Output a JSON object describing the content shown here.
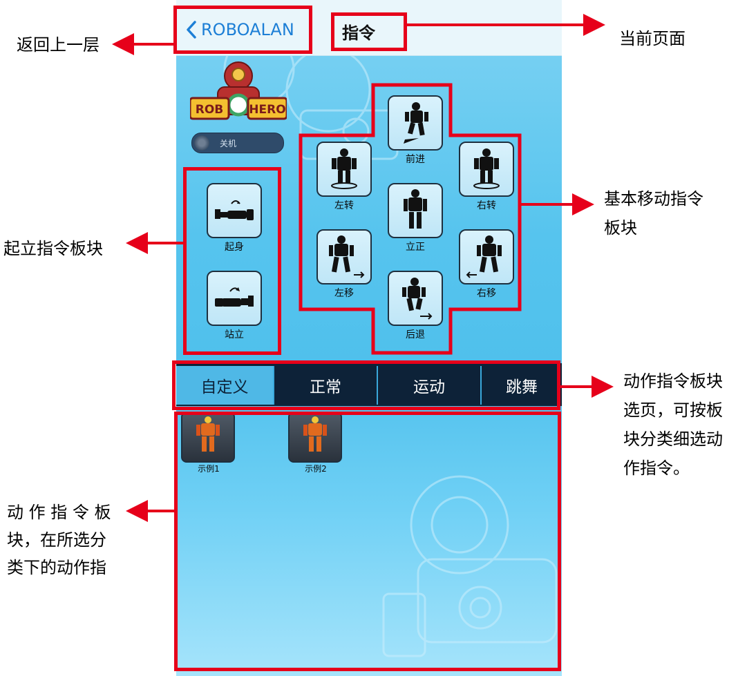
{
  "nav": {
    "back_label": "ROBOALAN",
    "title": "指令"
  },
  "logo": {
    "brand": "ROB HERO"
  },
  "power": {
    "label": "关机"
  },
  "standup": {
    "items": [
      {
        "label": "起身"
      },
      {
        "label": "站立"
      }
    ]
  },
  "movement": {
    "forward": "前进",
    "turn_left": "左转",
    "stand_straight": "立正",
    "turn_right": "右转",
    "move_left": "左移",
    "move_right": "右移",
    "backward": "后退"
  },
  "tabs": [
    "自定义",
    "正常",
    "运动",
    "跳舞"
  ],
  "actions": [
    {
      "label": "示例1"
    },
    {
      "label": "示例2"
    }
  ],
  "annotations": {
    "back": "返回上一层",
    "current_page": "当前页面",
    "standup_block": "起立指令板块",
    "movement_block_l1": "基本移动指令",
    "movement_block_l2": "板块",
    "tabs_l1": "动作指令板块",
    "tabs_l2": "选页，可按板",
    "tabs_l3": "块分类细选动",
    "tabs_l4": "作指令。",
    "actions_l1": "动 作 指 令 板",
    "actions_l2": "块，在所选分",
    "actions_l3": "类下的动作指"
  },
  "colors": {
    "annotation": "#e6001a",
    "nav_link": "#1d7fd6",
    "tab_bg": "#0d2238",
    "tab_active": "#4fb8e6"
  },
  "icons": [
    "chevron-left-icon",
    "power-icon",
    "robot-icon"
  ]
}
